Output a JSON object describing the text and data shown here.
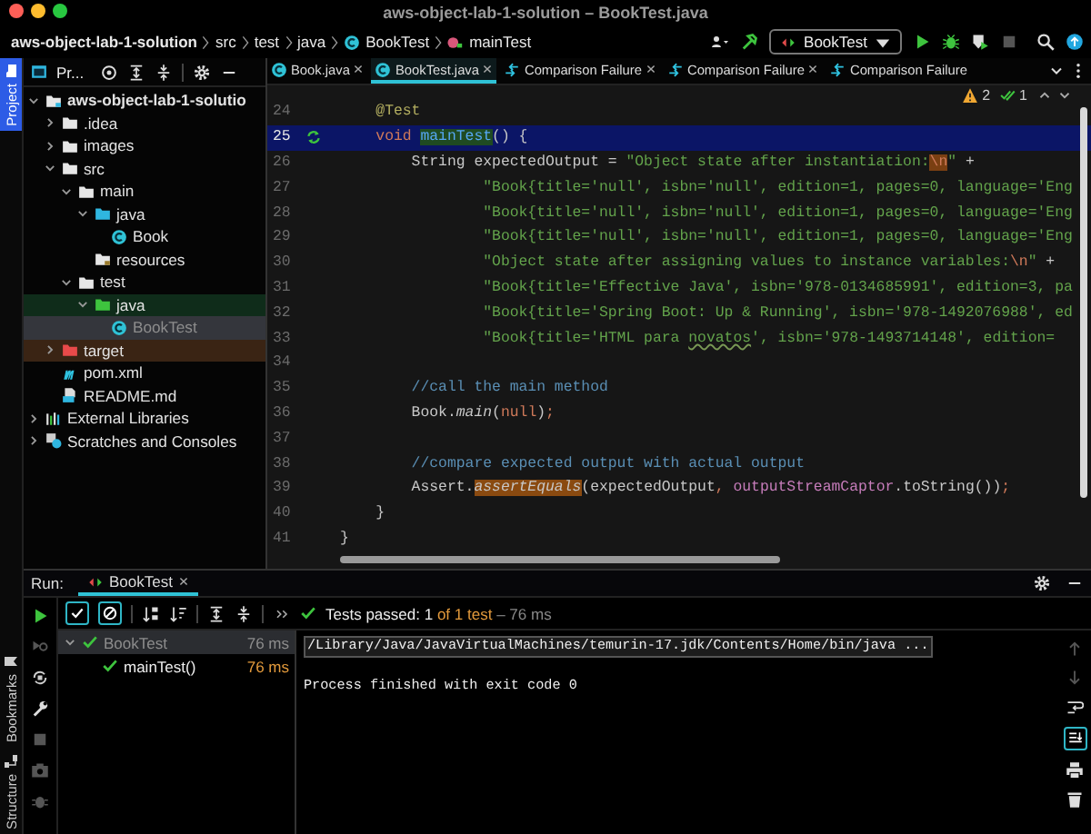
{
  "window": {
    "title": "aws-object-lab-1-solution – BookTest.java"
  },
  "navbar": {
    "breadcrumbs": [
      {
        "label": "aws-object-lab-1-solution",
        "kind": "project"
      },
      {
        "label": "src",
        "kind": "folder"
      },
      {
        "label": "test",
        "kind": "folder"
      },
      {
        "label": "java",
        "kind": "folder"
      },
      {
        "label": "BookTest",
        "kind": "class"
      },
      {
        "label": "mainTest",
        "kind": "method"
      }
    ],
    "run_config": "BookTest"
  },
  "side_tabs": [
    {
      "label": "Project",
      "kind": "project",
      "selected": true
    },
    {
      "label": "Bookmarks",
      "kind": "bookmarks",
      "selected": false
    },
    {
      "label": "Structure",
      "kind": "structure",
      "selected": false
    }
  ],
  "project": {
    "title": "Pr...",
    "tree": [
      {
        "label": "aws-object-lab-1-solutio",
        "kind": "module",
        "expanded": true,
        "selected": false,
        "children": [
          {
            "label": ".idea",
            "kind": "folder",
            "expanded": false,
            "selected": false
          },
          {
            "label": "images",
            "kind": "folder",
            "expanded": false,
            "selected": false
          },
          {
            "label": "src",
            "kind": "folder",
            "expanded": true,
            "selected": false,
            "children": [
              {
                "label": "main",
                "kind": "folder",
                "expanded": true,
                "selected": false,
                "children": [
                  {
                    "label": "java",
                    "kind": "source-root",
                    "expanded": true,
                    "selected": false,
                    "children": [
                      {
                        "label": "Book",
                        "kind": "class",
                        "selected": false
                      }
                    ]
                  },
                  {
                    "label": "resources",
                    "kind": "resources",
                    "selected": false
                  }
                ]
              },
              {
                "label": "test",
                "kind": "folder",
                "expanded": true,
                "selected": false,
                "children": [
                  {
                    "label": "java",
                    "kind": "test-root",
                    "expanded": true,
                    "selected": false,
                    "color": "#0f2c1a",
                    "children": [
                      {
                        "label": "BookTest",
                        "kind": "class",
                        "selected": true
                      }
                    ]
                  }
                ]
              }
            ]
          },
          {
            "label": "target",
            "kind": "excluded",
            "expanded": false,
            "selected": false,
            "color": "#3a2414"
          },
          {
            "label": "pom.xml",
            "kind": "maven",
            "selected": false
          },
          {
            "label": "README.md",
            "kind": "markdown",
            "selected": false
          }
        ]
      },
      {
        "label": "External Libraries",
        "kind": "libraries",
        "expanded": false,
        "selected": false
      },
      {
        "label": "Scratches and Consoles",
        "kind": "scratches",
        "expanded": false,
        "selected": false
      }
    ]
  },
  "editor": {
    "tabs": [
      {
        "label": "Book.java",
        "kind": "class",
        "selected": false,
        "closable": true
      },
      {
        "label": "BookTest.java",
        "kind": "class",
        "selected": true,
        "closable": true
      },
      {
        "label": "Comparison Failure",
        "kind": "diff",
        "selected": false,
        "closable": true
      },
      {
        "label": "Comparison Failure",
        "kind": "diff",
        "selected": false,
        "closable": true
      },
      {
        "label": "Comparison Failure",
        "kind": "diff",
        "selected": false,
        "closable": false
      }
    ],
    "inspections": {
      "warnings": "2",
      "passed": "1"
    },
    "lines": [
      {
        "number": "24",
        "current": false,
        "runnable": false,
        "tokens": [
          {
            "kind": "annotation",
            "text": "    @Test"
          }
        ]
      },
      {
        "number": "25",
        "current": true,
        "runnable": true,
        "tokens": [
          {
            "kind": "keyword",
            "text": "    void "
          },
          {
            "kind": "usage",
            "text": "mainTest"
          },
          {
            "kind": "plain",
            "text": "() {"
          }
        ]
      },
      {
        "number": "26",
        "current": false,
        "runnable": false,
        "tokens": [
          {
            "kind": "plain",
            "text": "        String expectedOutput = "
          },
          {
            "kind": "string",
            "text": "\"Object state after instantiation:"
          },
          {
            "kind": "escape-match",
            "text": "\\n"
          },
          {
            "kind": "string",
            "text": "\""
          },
          {
            "kind": "plain",
            "text": " +"
          }
        ]
      },
      {
        "number": "27",
        "current": false,
        "runnable": false,
        "tokens": [
          {
            "kind": "string",
            "text": "                \"Book{title='null', isbn='null', edition=1, pages=0, language='Eng"
          }
        ]
      },
      {
        "number": "28",
        "current": false,
        "runnable": false,
        "tokens": [
          {
            "kind": "string",
            "text": "                \"Book{title='null', isbn='null', edition=1, pages=0, language='Eng"
          }
        ]
      },
      {
        "number": "29",
        "current": false,
        "runnable": false,
        "tokens": [
          {
            "kind": "string",
            "text": "                \"Book{title='null', isbn='null', edition=1, pages=0, language='Eng"
          }
        ]
      },
      {
        "number": "30",
        "current": false,
        "runnable": false,
        "tokens": [
          {
            "kind": "string",
            "text": "                \"Object state after assigning values to instance variables:"
          },
          {
            "kind": "escape",
            "text": "\\n"
          },
          {
            "kind": "string",
            "text": "\""
          },
          {
            "kind": "plain",
            "text": " +"
          }
        ]
      },
      {
        "number": "31",
        "current": false,
        "runnable": false,
        "tokens": [
          {
            "kind": "string",
            "text": "                \"Book{title='Effective Java', isbn='978-0134685991', edition=3, pa"
          }
        ]
      },
      {
        "number": "32",
        "current": false,
        "runnable": false,
        "tokens": [
          {
            "kind": "string",
            "text": "                \"Book{title='Spring Boot: Up & Running', isbn='978-1492076988', ed"
          }
        ]
      },
      {
        "number": "33",
        "current": false,
        "runnable": false,
        "tokens": [
          {
            "kind": "string",
            "text": "                \"Book{title='HTML para "
          },
          {
            "kind": "string-typo",
            "text": "novatos"
          },
          {
            "kind": "string",
            "text": "', isbn='978-1493714148', edition="
          }
        ]
      },
      {
        "number": "34",
        "current": false,
        "runnable": false
      },
      {
        "number": "35",
        "current": false,
        "runnable": false,
        "tokens": [
          {
            "kind": "comment",
            "text": "        //call the main method"
          }
        ]
      },
      {
        "number": "36",
        "current": false,
        "runnable": false,
        "tokens": [
          {
            "kind": "plain",
            "text": "        Book."
          },
          {
            "kind": "static-call",
            "text": "main"
          },
          {
            "kind": "plain",
            "text": "("
          },
          {
            "kind": "keyword",
            "text": "null"
          },
          {
            "kind": "plain",
            "text": ")"
          },
          {
            "kind": "keyword",
            "text": ";"
          }
        ]
      },
      {
        "number": "37",
        "current": false,
        "runnable": false
      },
      {
        "number": "38",
        "current": false,
        "runnable": false,
        "tokens": [
          {
            "kind": "comment",
            "text": "        //compare expected output with actual output"
          }
        ]
      },
      {
        "number": "39",
        "current": false,
        "runnable": false,
        "tokens": [
          {
            "kind": "plain",
            "text": "        Assert."
          },
          {
            "kind": "static-call-match",
            "text": "assertEquals"
          },
          {
            "kind": "plain",
            "text": "(expectedOutput"
          },
          {
            "kind": "keyword",
            "text": ", "
          },
          {
            "kind": "field",
            "text": "outputStreamCaptor"
          },
          {
            "kind": "plain",
            "text": ".toString())"
          },
          {
            "kind": "keyword",
            "text": ";"
          }
        ]
      },
      {
        "number": "40",
        "current": false,
        "runnable": false,
        "tokens": [
          {
            "kind": "plain",
            "text": "    }"
          }
        ]
      },
      {
        "number": "41",
        "current": false,
        "runnable": false,
        "tokens": [
          {
            "kind": "plain",
            "text": "}"
          }
        ]
      }
    ]
  },
  "run": {
    "label": "Run:",
    "tab": "BookTest",
    "status": {
      "label": "Tests passed:",
      "passed": "1",
      "total": "of 1 test",
      "time": "– 76 ms"
    },
    "tests": [
      {
        "label": "BookTest",
        "time": "76 ms",
        "selected": true,
        "children": [
          {
            "label": "mainTest()",
            "time": "76 ms",
            "selected": false
          }
        ]
      }
    ],
    "console": [
      {
        "kind": "command",
        "text": "/Library/Java/JavaVirtualMachines/temurin-17.jdk/Contents/Home/bin/java ..."
      },
      {
        "kind": "output",
        "text": "Process finished with exit code 0"
      }
    ],
    "scroll_to_end": {
      "on": true
    }
  }
}
